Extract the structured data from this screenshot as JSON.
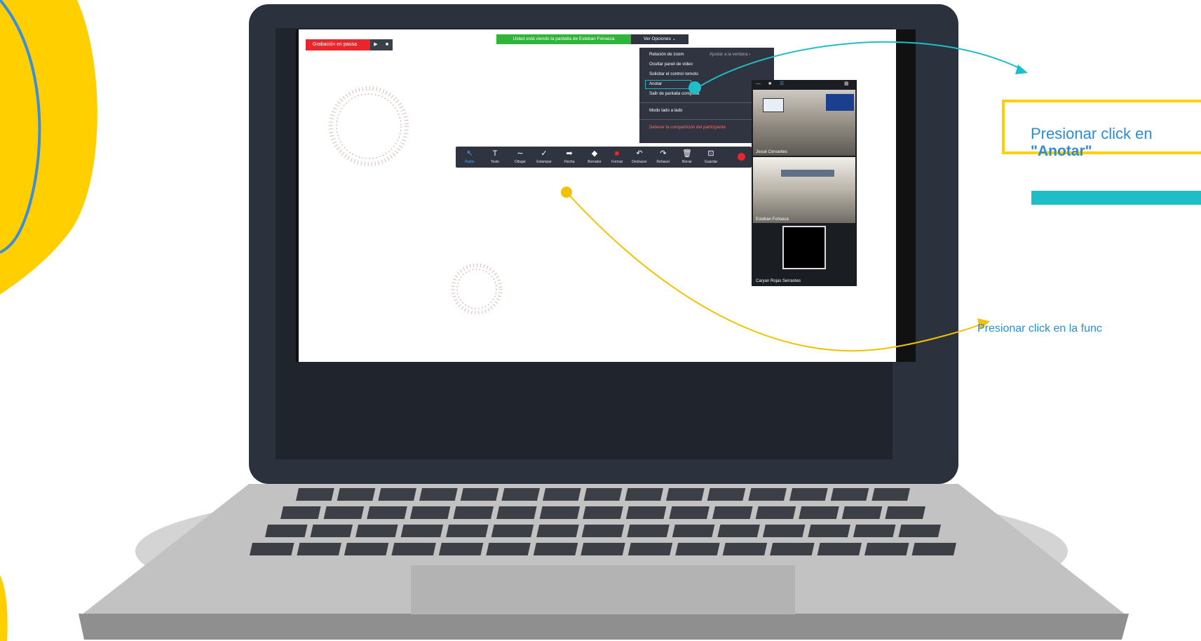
{
  "recording": {
    "label": "Grabación en pausa",
    "play": "▶",
    "stop": "■"
  },
  "banner": {
    "viewing_text": "Usted está viendo la pantalla de Esteban Fonseca",
    "options_label": "Ver Opciones ⌄"
  },
  "menu": {
    "zoom_ratio": "Relación de zoom",
    "zoom_ratio_value": "Ajustar a la ventana ›",
    "hide_video": "Ocultar panel de video",
    "request_control": "Solicitar el control remoto",
    "annotate": "Anotar",
    "exit_fullscreen": "Salir de pantalla completa",
    "side_by_side": "Modo lado a lado",
    "stop_share": "Detener la compartición del participante"
  },
  "toolbar": {
    "tools": [
      {
        "icon": "↖",
        "label": "Ratón"
      },
      {
        "icon": "T",
        "label": "Texto"
      },
      {
        "icon": "∼",
        "label": "Dibujar"
      },
      {
        "icon": "✓",
        "label": "Estampar"
      },
      {
        "icon": "➡",
        "label": "Flecha"
      },
      {
        "icon": "◆",
        "label": "Borrador"
      },
      {
        "icon": "■",
        "label": "Format"
      },
      {
        "icon": "↶",
        "label": "Deshacer"
      },
      {
        "icon": "↷",
        "label": "Rehacer"
      },
      {
        "icon": "🗑",
        "label": "Borrar"
      },
      {
        "icon": "⊡",
        "label": "Guardar"
      }
    ]
  },
  "participants": [
    {
      "name": "Josué Cervantes"
    },
    {
      "name": "Esteban Fonseca"
    },
    {
      "name": "Caryan Rojas Serrantes"
    }
  ],
  "callouts": {
    "annotate_prefix": "Presionar click en",
    "annotate_bold": "\"Anotar\"",
    "function_text": "Presionar click en la func"
  },
  "colors": {
    "accent_teal": "#1fbdc7",
    "accent_yellow": "#ffcf00",
    "laptop": "#2b313d",
    "text_blue": "#2c8cd6"
  }
}
